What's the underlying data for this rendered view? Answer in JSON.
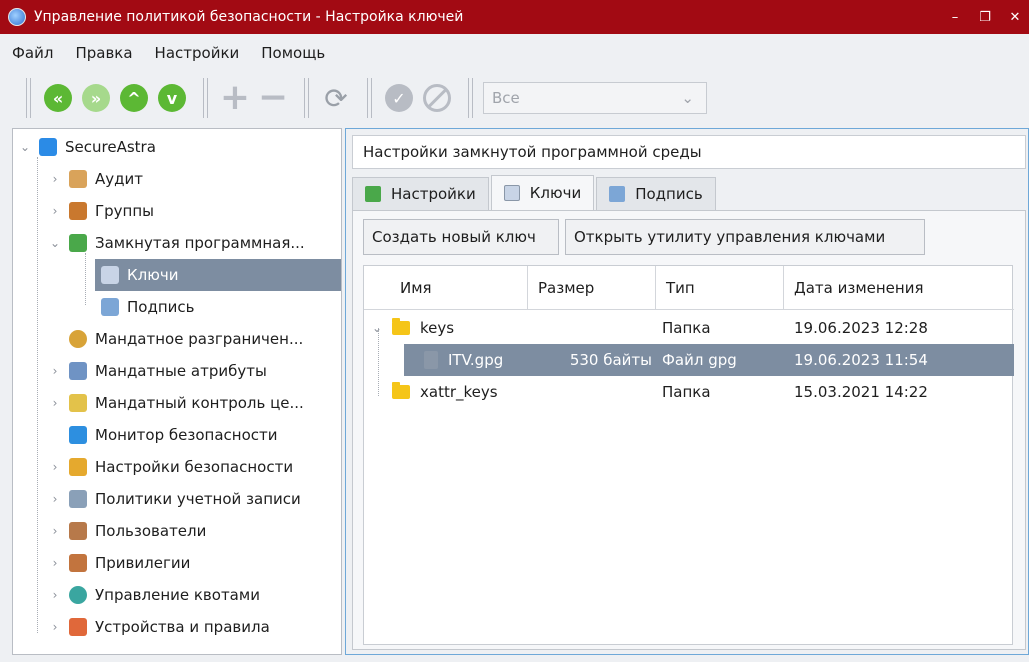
{
  "window": {
    "title": "Управление политикой безопасности - Настройка ключей",
    "controls": {
      "minimize": "–",
      "maximize": "❐",
      "close": "✕"
    }
  },
  "menu": [
    "Файл",
    "Правка",
    "Настройки",
    "Помощь"
  ],
  "toolbar": {
    "icons": {
      "first": "«",
      "prev": "»",
      "up": "^",
      "down": "v",
      "add": "+",
      "remove": "−",
      "refresh": "⟳"
    },
    "filter_value": "Все",
    "filter_arrow": "⌄"
  },
  "tree": {
    "root": "SecureAstra",
    "items": [
      {
        "label": "Аудит"
      },
      {
        "label": "Группы"
      },
      {
        "label": "Замкнутая программная..."
      },
      {
        "label": "Ключи"
      },
      {
        "label": "Подпись"
      },
      {
        "label": "Мандатное разграничен..."
      },
      {
        "label": "Мандатные атрибуты"
      },
      {
        "label": "Мандатный контроль це..."
      },
      {
        "label": "Монитор безопасности"
      },
      {
        "label": "Настройки безопасности"
      },
      {
        "label": "Политики учетной записи"
      },
      {
        "label": "Пользователи"
      },
      {
        "label": "Привилегии"
      },
      {
        "label": "Управление квотами"
      },
      {
        "label": "Устройства и правила"
      }
    ],
    "expander_collapsed": "›",
    "expander_expanded": "⌄"
  },
  "panel": {
    "header": "Настройки замкнутой программной среды",
    "tabs": [
      "Настройки",
      "Ключи",
      "Подпись"
    ],
    "buttons": {
      "create_key": "Создать новый ключ",
      "open_utility": "Открыть утилиту управления ключами"
    },
    "columns": [
      "Имя",
      "Размер",
      "Тип",
      "Дата изменения"
    ],
    "rows": [
      {
        "name": "keys",
        "size": "",
        "type": "Папка",
        "date": "19.06.2023 12:28"
      },
      {
        "name": "ITV.gpg",
        "size": "530 байты",
        "type": "Файл gpg",
        "date": "19.06.2023 11:54"
      },
      {
        "name": "xattr_keys",
        "size": "",
        "type": "Папка",
        "date": "15.03.2021 14:22"
      }
    ]
  },
  "colors": {
    "titlebar": "#a20a13",
    "selection": "#7d8da1",
    "toolbar_green": "#5cb834",
    "focus_border": "#6ea8d8"
  }
}
